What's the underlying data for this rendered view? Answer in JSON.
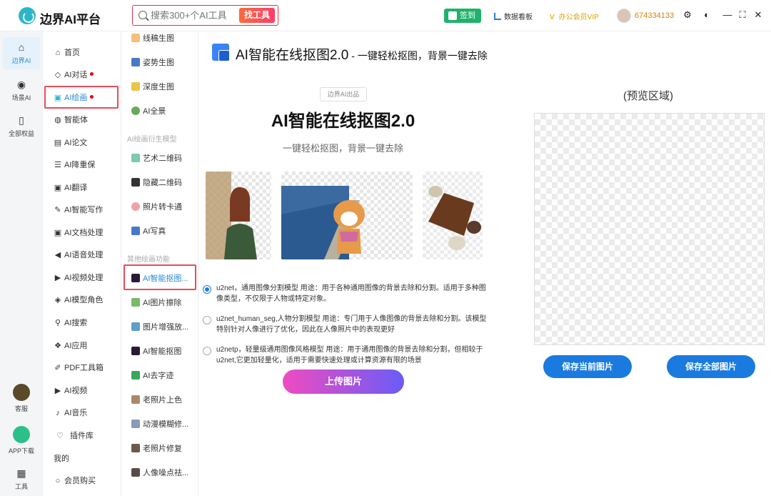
{
  "app": {
    "name": "边界AI平台"
  },
  "search": {
    "placeholder": "搜索300+个AI工具",
    "button": "找工具"
  },
  "topbar": {
    "signin": "签到",
    "dashboard": "数据看板",
    "vip": "办公会员VIP",
    "user_id": "674334133"
  },
  "sidebar1": {
    "items": [
      {
        "label": "边界AI",
        "icon": "home-icon"
      },
      {
        "label": "场景AI",
        "icon": "bulb-icon"
      },
      {
        "label": "全部权益",
        "icon": "bookmark-icon"
      },
      {
        "label": "客服",
        "icon": "support-icon"
      },
      {
        "label": "APP下载",
        "icon": "phone-icon"
      },
      {
        "label": "工具",
        "icon": "grid-icon"
      }
    ]
  },
  "sidebar2": {
    "items": [
      {
        "label": "首页"
      },
      {
        "label": "AI对话"
      },
      {
        "label": "AI绘画"
      },
      {
        "label": "智能体"
      },
      {
        "label": "AI论文"
      },
      {
        "label": "AI降重保"
      },
      {
        "label": "AI翻译"
      },
      {
        "label": "AI智能写作"
      },
      {
        "label": "AI文档处理"
      },
      {
        "label": "AI语音处理"
      },
      {
        "label": "AI视频处理"
      },
      {
        "label": "AI模型角色"
      },
      {
        "label": "AI搜索"
      },
      {
        "label": "AI应用"
      },
      {
        "label": "PDF工具箱"
      },
      {
        "label": "AI视频"
      },
      {
        "label": "AI音乐"
      },
      {
        "label": "插件库"
      },
      {
        "label": "我的"
      },
      {
        "label": "会员购买"
      }
    ]
  },
  "sidebar3": {
    "items": [
      {
        "label": "线稿生图"
      },
      {
        "label": "姿势生图"
      },
      {
        "label": "深度生图"
      },
      {
        "label": "AI全景"
      },
      {
        "label": "艺术二维码"
      },
      {
        "label": "隐藏二维码"
      },
      {
        "label": "照片转卡通"
      },
      {
        "label": "AI写真"
      },
      {
        "label": "AI智能抠图..."
      },
      {
        "label": "AI图片擦除"
      },
      {
        "label": "图片增强放..."
      },
      {
        "label": "AI智能抠图"
      },
      {
        "label": "AI去字迹"
      },
      {
        "label": "老照片上色"
      },
      {
        "label": "动漫模糊修..."
      },
      {
        "label": "老照片修复"
      },
      {
        "label": "人像噪点祛..."
      }
    ],
    "headings": [
      "AI绘画衍生模型",
      "其他绘画功能"
    ]
  },
  "main": {
    "title": "AI智能在线抠图2.0",
    "title_suffix": " - 一键轻松抠图，背景一键去除",
    "badge": "边界AI出品",
    "big_title": "AI智能在线抠图2.0",
    "subtitle": "一键轻松抠图，背景一键去除",
    "options": [
      {
        "text": "u2net，通用图像分割模型 用途：用于各种通用图像的背景去除和分割。适用于多种图像类型，不仅限于人物或特定对象。",
        "selected": true
      },
      {
        "text": "u2net_human_seg,人物分割模型 用途：专门用于人像图像的背景去除和分割。该模型特别针对人像进行了优化，因此在人像照片中的表现更好",
        "selected": false
      },
      {
        "text": "u2netp，轻量级通用图像风格模型 用途：用于通用图像的背景去除和分割，但相较于u2net,它更加轻量化，适用于需要快速处理或计算资源有限的场景",
        "selected": false
      }
    ],
    "upload": "上传图片",
    "preview_title": "(预览区域)",
    "save_current": "保存当前图片",
    "save_all": "保存全部图片"
  },
  "colors": {
    "accent": "#1a7ae0",
    "highlight": "#e74c5a",
    "brand": "#2cb5c8"
  }
}
